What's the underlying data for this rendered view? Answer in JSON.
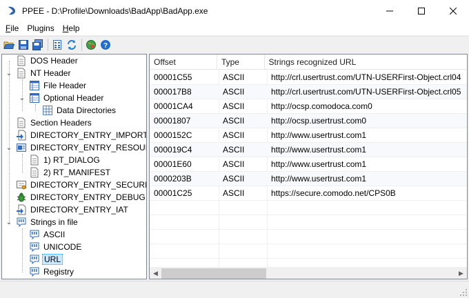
{
  "window": {
    "title": "PPEE - D:\\Profile\\Downloads\\BadApp\\BadApp.exe",
    "controls": [
      "minimize",
      "maximize",
      "close"
    ]
  },
  "menu": [
    {
      "label": "File",
      "key": "F"
    },
    {
      "label": "Plugins",
      "key": ""
    },
    {
      "label": "Help",
      "key": "H"
    }
  ],
  "toolbar": {
    "buttons": [
      "open-folder-icon",
      "save-icon",
      "save-all-icon",
      "hex-view-icon",
      "refresh-icon",
      "plugins-globe-icon",
      "help-icon"
    ]
  },
  "tree": {
    "items": [
      {
        "label": "DOS Header",
        "icon": "document-icon"
      },
      {
        "label": "NT Header",
        "icon": "document-icon"
      },
      {
        "label": "File Header",
        "icon": "table-icon"
      },
      {
        "label": "Optional Header",
        "icon": "table-icon"
      },
      {
        "label": "Data Directories",
        "icon": "grid-icon"
      },
      {
        "label": "Section Headers",
        "icon": "document-icon"
      },
      {
        "label": "DIRECTORY_ENTRY_IMPORT",
        "icon": "import-icon"
      },
      {
        "label": "DIRECTORY_ENTRY_RESOURCE",
        "icon": "resource-icon"
      },
      {
        "label": "1) RT_DIALOG",
        "icon": "document-icon"
      },
      {
        "label": "2) RT_MANIFEST",
        "icon": "document-icon"
      },
      {
        "label": "DIRECTORY_ENTRY_SECURITY",
        "icon": "certificate-icon"
      },
      {
        "label": "DIRECTORY_ENTRY_DEBUG",
        "icon": "bug-icon"
      },
      {
        "label": "DIRECTORY_ENTRY_IAT",
        "icon": "import-icon"
      },
      {
        "label": "Strings in file",
        "icon": "strings-icon"
      },
      {
        "label": "ASCII",
        "icon": "strings-icon"
      },
      {
        "label": "UNICODE",
        "icon": "strings-icon"
      },
      {
        "label": "URL",
        "icon": "strings-icon"
      },
      {
        "label": "Registry",
        "icon": "strings-icon"
      }
    ],
    "selected": "URL"
  },
  "table": {
    "columns": [
      "Offset",
      "Type",
      "Strings recognized URL"
    ],
    "rows": [
      {
        "offset": "00001C55",
        "type": "ASCII",
        "url": "http://crl.usertrust.com/UTN-USERFirst-Object.crl04"
      },
      {
        "offset": "000017B8",
        "type": "ASCII",
        "url": "http://crl.usertrust.com/UTN-USERFirst-Object.crl05"
      },
      {
        "offset": "00001CA4",
        "type": "ASCII",
        "url": "http://ocsp.comodoca.com0"
      },
      {
        "offset": "00001807",
        "type": "ASCII",
        "url": "http://ocsp.usertrust.com0"
      },
      {
        "offset": "0000152C",
        "type": "ASCII",
        "url": "http://www.usertrust.com1"
      },
      {
        "offset": "000019C4",
        "type": "ASCII",
        "url": "http://www.usertrust.com1"
      },
      {
        "offset": "00001E60",
        "type": "ASCII",
        "url": "http://www.usertrust.com1"
      },
      {
        "offset": "0000203B",
        "type": "ASCII",
        "url": "http://www.usertrust.com1"
      },
      {
        "offset": "00001C25",
        "type": "ASCII",
        "url": "https://secure.comodo.net/CPS0B"
      }
    ]
  },
  "colors": {
    "selection": "#cce8ff",
    "accent_blue": "#1f5fbf"
  }
}
